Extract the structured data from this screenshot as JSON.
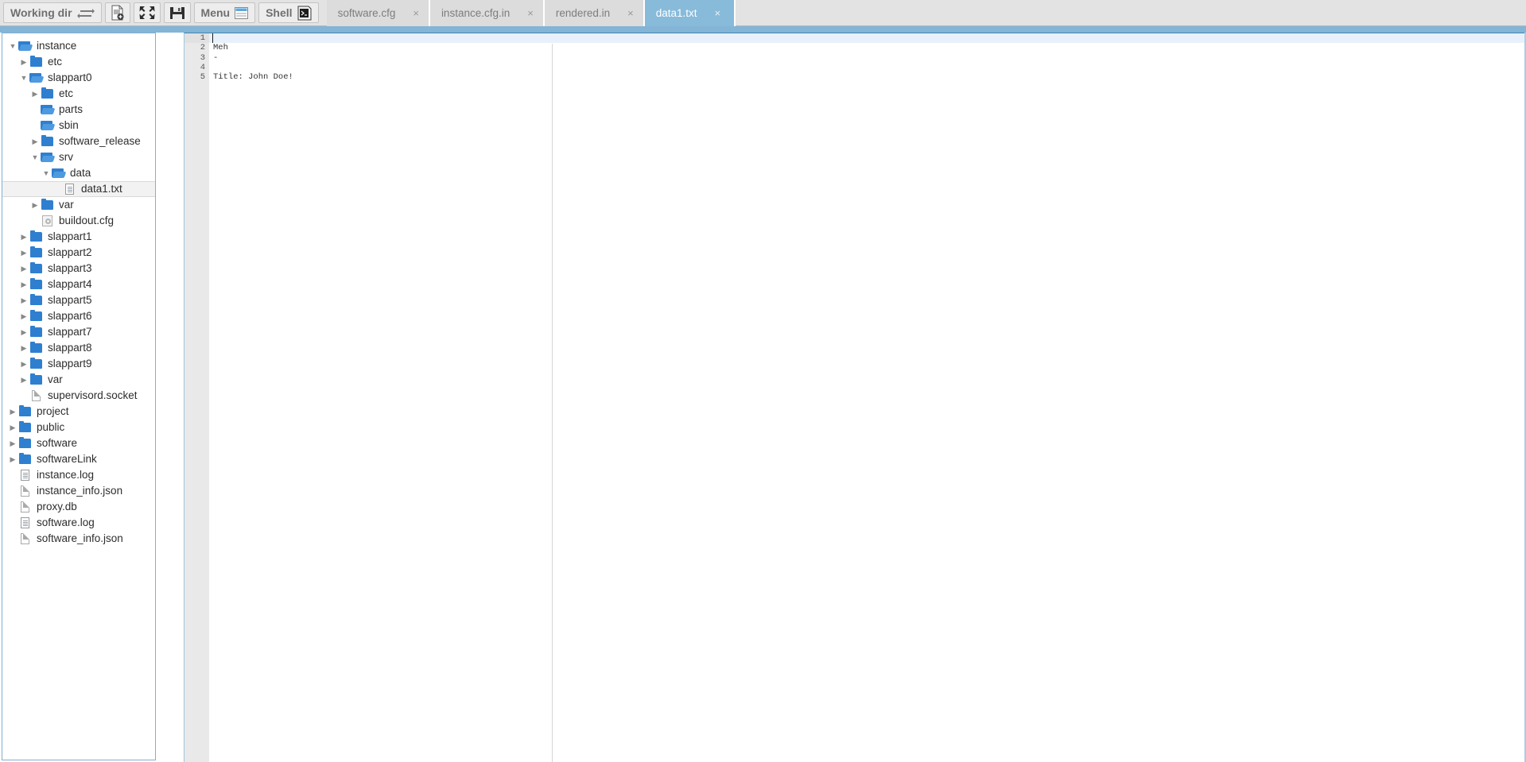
{
  "toolbar": {
    "working_dir_label": "Working dir",
    "working_dir_icon": "swap-arrows-icon",
    "new_file_label": "",
    "new_file_icon": "document-add-icon",
    "collapse_label": "",
    "collapse_icon": "collapse-arrows-icon",
    "save_label": "",
    "save_icon": "floppy-save-icon",
    "menu_label": "Menu",
    "menu_icon": "menu-list-icon",
    "shell_label": "Shell",
    "shell_icon": "terminal-icon"
  },
  "tabs": [
    {
      "label": "software.cfg",
      "close": "×",
      "active": false
    },
    {
      "label": "instance.cfg.in",
      "close": "×",
      "active": false
    },
    {
      "label": "rendered.in",
      "close": "×",
      "active": false
    },
    {
      "label": "data1.txt",
      "close": "×",
      "active": true
    }
  ],
  "tree": [
    {
      "label": "instance",
      "depth": 0,
      "twisty": "open",
      "icon": "folder-open-icon",
      "selected": false
    },
    {
      "label": "etc",
      "depth": 1,
      "twisty": "closed",
      "icon": "folder-closed-icon",
      "selected": false
    },
    {
      "label": "slappart0",
      "depth": 1,
      "twisty": "open",
      "icon": "folder-open-icon",
      "selected": false
    },
    {
      "label": "etc",
      "depth": 2,
      "twisty": "closed",
      "icon": "folder-closed-icon",
      "selected": false
    },
    {
      "label": "parts",
      "depth": 2,
      "twisty": "blank",
      "icon": "folder-open-icon",
      "selected": false
    },
    {
      "label": "sbin",
      "depth": 2,
      "twisty": "blank",
      "icon": "folder-open-icon",
      "selected": false
    },
    {
      "label": "software_release",
      "depth": 2,
      "twisty": "closed",
      "icon": "folder-closed-icon",
      "selected": false
    },
    {
      "label": "srv",
      "depth": 2,
      "twisty": "open",
      "icon": "folder-open-icon",
      "selected": false
    },
    {
      "label": "data",
      "depth": 3,
      "twisty": "open",
      "icon": "folder-open-icon",
      "selected": false
    },
    {
      "label": "data1.txt",
      "depth": 4,
      "twisty": "blank",
      "icon": "file-lined-icon",
      "selected": true
    },
    {
      "label": "var",
      "depth": 2,
      "twisty": "closed",
      "icon": "folder-closed-icon",
      "selected": false
    },
    {
      "label": "buildout.cfg",
      "depth": 2,
      "twisty": "blank",
      "icon": "file-cfg-icon",
      "selected": false
    },
    {
      "label": "slappart1",
      "depth": 1,
      "twisty": "closed",
      "icon": "folder-closed-icon",
      "selected": false
    },
    {
      "label": "slappart2",
      "depth": 1,
      "twisty": "closed",
      "icon": "folder-closed-icon",
      "selected": false
    },
    {
      "label": "slappart3",
      "depth": 1,
      "twisty": "closed",
      "icon": "folder-closed-icon",
      "selected": false
    },
    {
      "label": "slappart4",
      "depth": 1,
      "twisty": "closed",
      "icon": "folder-closed-icon",
      "selected": false
    },
    {
      "label": "slappart5",
      "depth": 1,
      "twisty": "closed",
      "icon": "folder-closed-icon",
      "selected": false
    },
    {
      "label": "slappart6",
      "depth": 1,
      "twisty": "closed",
      "icon": "folder-closed-icon",
      "selected": false
    },
    {
      "label": "slappart7",
      "depth": 1,
      "twisty": "closed",
      "icon": "folder-closed-icon",
      "selected": false
    },
    {
      "label": "slappart8",
      "depth": 1,
      "twisty": "closed",
      "icon": "folder-closed-icon",
      "selected": false
    },
    {
      "label": "slappart9",
      "depth": 1,
      "twisty": "closed",
      "icon": "folder-closed-icon",
      "selected": false
    },
    {
      "label": "var",
      "depth": 1,
      "twisty": "closed",
      "icon": "folder-closed-icon",
      "selected": false
    },
    {
      "label": "supervisord.socket",
      "depth": 1,
      "twisty": "blank",
      "icon": "file-plain-icon",
      "selected": false
    },
    {
      "label": "project",
      "depth": 0,
      "twisty": "closed",
      "icon": "folder-closed-icon",
      "selected": false
    },
    {
      "label": "public",
      "depth": 0,
      "twisty": "closed",
      "icon": "folder-closed-icon",
      "selected": false
    },
    {
      "label": "software",
      "depth": 0,
      "twisty": "closed",
      "icon": "folder-closed-icon",
      "selected": false
    },
    {
      "label": "softwareLink",
      "depth": 0,
      "twisty": "closed",
      "icon": "folder-closed-icon",
      "selected": false
    },
    {
      "label": "instance.log",
      "depth": 0,
      "twisty": "blank",
      "icon": "file-lined-icon",
      "selected": false
    },
    {
      "label": "instance_info.json",
      "depth": 0,
      "twisty": "blank",
      "icon": "file-plain-icon",
      "selected": false
    },
    {
      "label": "proxy.db",
      "depth": 0,
      "twisty": "blank",
      "icon": "file-plain-icon",
      "selected": false
    },
    {
      "label": "software.log",
      "depth": 0,
      "twisty": "blank",
      "icon": "file-lined-icon",
      "selected": false
    },
    {
      "label": "software_info.json",
      "depth": 0,
      "twisty": "blank",
      "icon": "file-plain-icon",
      "selected": false
    }
  ],
  "editor": {
    "active_line": 1,
    "lines": [
      {
        "num": "1",
        "text": ""
      },
      {
        "num": "2",
        "text": "Meh"
      },
      {
        "num": "3",
        "text": "-"
      },
      {
        "num": "4",
        "text": ""
      },
      {
        "num": "5",
        "text": "Title: John Doe!"
      }
    ]
  },
  "colors": {
    "accent": "#84b4d6",
    "active_tab_bg": "#88bada",
    "toolbar_bg": "#e3e3e3",
    "tab_bg": "#dcdcdc",
    "gutter_bg": "#e9e9e9",
    "active_line_bg": "#e8f1fb",
    "folder_blue": "#2f7fd0"
  }
}
